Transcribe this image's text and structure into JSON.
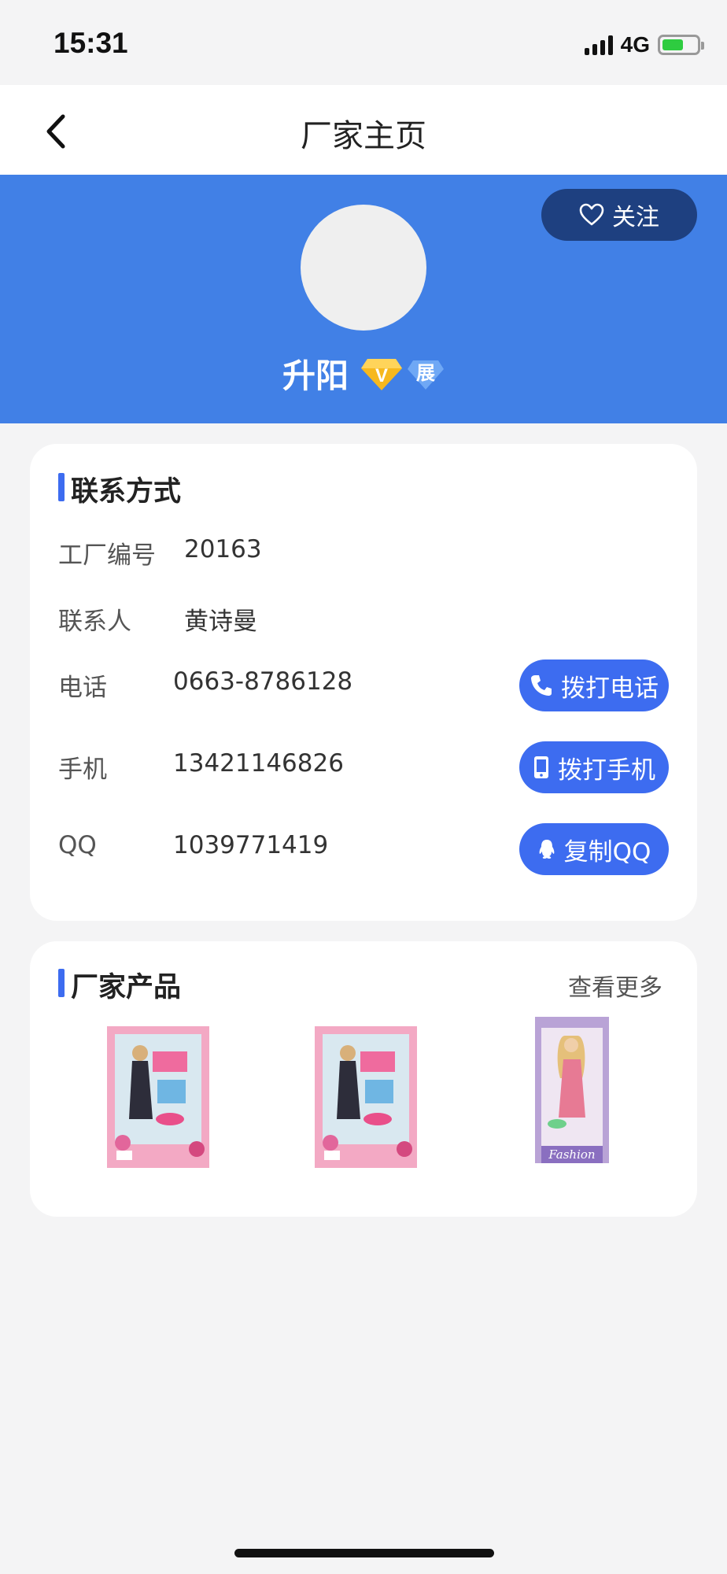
{
  "status_bar": {
    "time": "15:31",
    "network": "4G"
  },
  "nav": {
    "title": "厂家主页"
  },
  "banner": {
    "follow_label": "关注",
    "factory_name": "升阳",
    "badge_v": "V",
    "badge_exhibit": "展"
  },
  "contact": {
    "title": "联系方式",
    "rows": [
      {
        "label": "工厂编号",
        "value": "20163"
      },
      {
        "label": "联系人",
        "value": "黄诗曼"
      },
      {
        "label": "电话",
        "value": "0663-8786128",
        "action": "拨打电话"
      },
      {
        "label": "手机",
        "value": "13421146826",
        "action": "拨打手机"
      },
      {
        "label": "QQ",
        "value": "1039771419",
        "action": "复制QQ"
      }
    ]
  },
  "products": {
    "title": "厂家产品",
    "view_more": "查看更多",
    "items": [
      {
        "icon": "doll-pink-box-image"
      },
      {
        "icon": "doll-pink-box-image"
      },
      {
        "icon": "doll-fashion-box-image",
        "brand_text": "Fashion"
      }
    ]
  },
  "colors": {
    "accent": "#3d6cf0",
    "banner": "#4180e6",
    "follow_bg": "#1e4080"
  }
}
